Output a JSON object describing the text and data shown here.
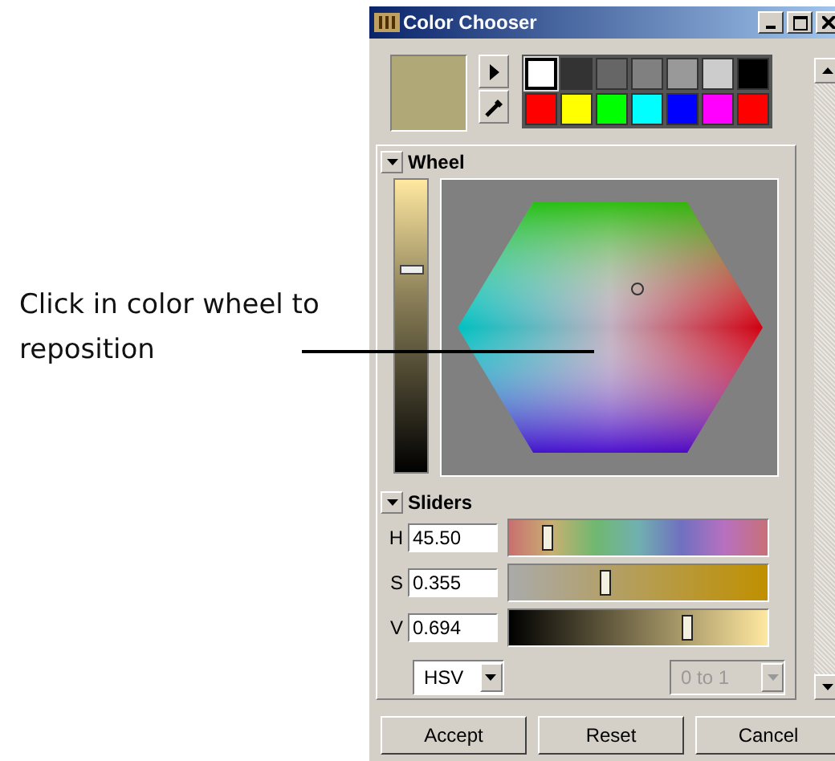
{
  "callout": {
    "text": "Click in color wheel to reposition"
  },
  "window": {
    "title": "Color Chooser"
  },
  "palette": [
    {
      "color": "#ffffff",
      "selected": true
    },
    {
      "color": "#333333",
      "selected": false
    },
    {
      "color": "#666666",
      "selected": false
    },
    {
      "color": "#808080",
      "selected": false
    },
    {
      "color": "#999999",
      "selected": false
    },
    {
      "color": "#cccccc",
      "selected": false
    },
    {
      "color": "#000000",
      "selected": false
    },
    {
      "color": "#ff0000",
      "selected": false
    },
    {
      "color": "#ffff00",
      "selected": false
    },
    {
      "color": "#00ff00",
      "selected": false
    },
    {
      "color": "#00ffff",
      "selected": false
    },
    {
      "color": "#0000ff",
      "selected": false
    },
    {
      "color": "#ff00ff",
      "selected": false
    },
    {
      "color": "#ff0000",
      "selected": false
    }
  ],
  "current_color": {
    "color": "#b1a877"
  },
  "wheel": {
    "title": "Wheel",
    "expanded": true,
    "level": 0.694
  },
  "sliders": {
    "title": "Sliders",
    "expanded": true,
    "rows": [
      {
        "label": "H",
        "value": "45.50",
        "level": 0.15,
        "kind": "hue"
      },
      {
        "label": "S",
        "value": "0.355",
        "level": 0.37,
        "kind": "saturation"
      },
      {
        "label": "V",
        "value": "0.694",
        "level": 0.69,
        "kind": "value"
      }
    ],
    "mode": {
      "value": "HSV",
      "disabled": false
    },
    "range": {
      "value": "0 to 1",
      "disabled": true
    }
  },
  "buttons": [
    "Accept",
    "Reset",
    "Cancel"
  ]
}
